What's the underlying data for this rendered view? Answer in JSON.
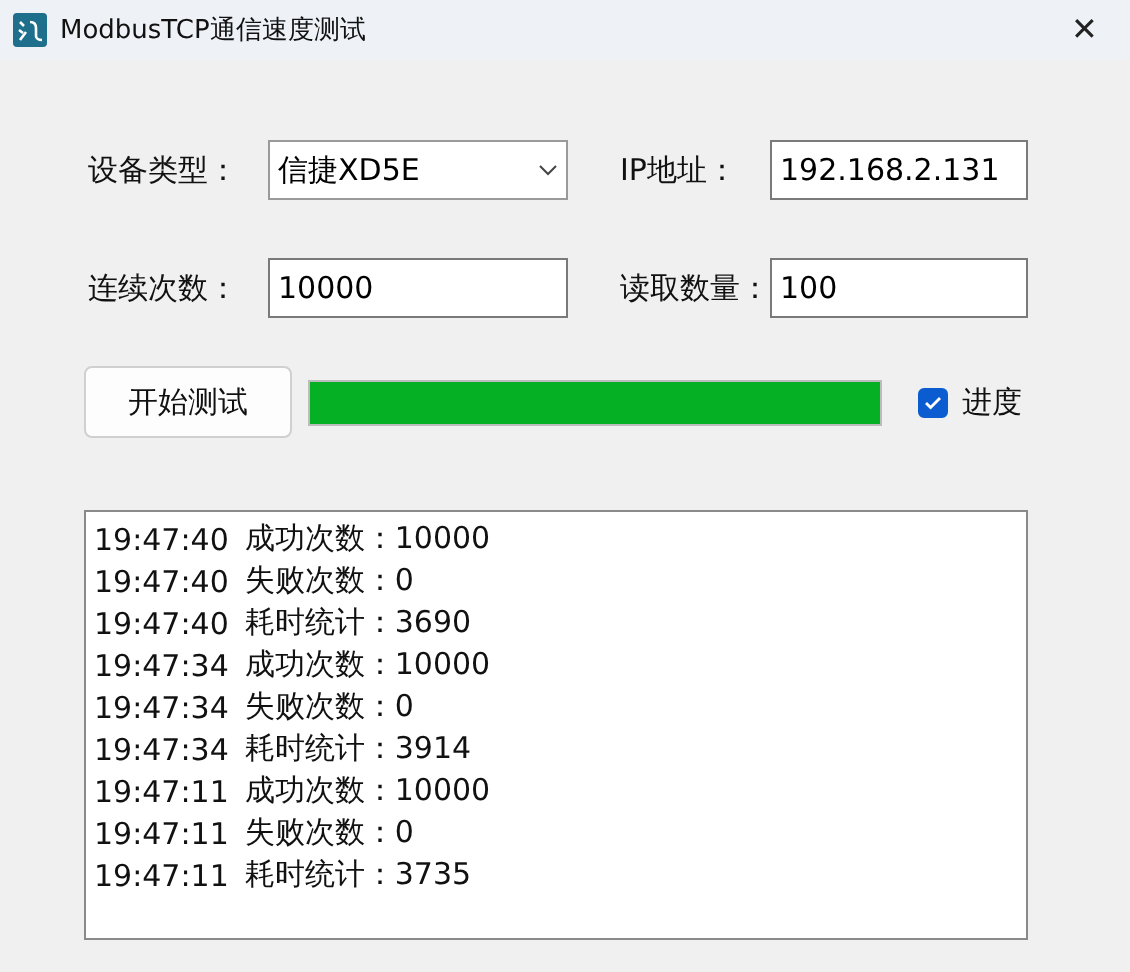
{
  "window": {
    "title": "ModbusTCP通信速度测试",
    "close": "✕"
  },
  "device_type": {
    "label": "设备类型：",
    "value": "信捷XD5E"
  },
  "ip_address": {
    "label": "IP地址：",
    "value": "192.168.2.131"
  },
  "repeat_count": {
    "label": "连续次数：",
    "value": "10000"
  },
  "read_count": {
    "label": "读取数量：",
    "value": "100"
  },
  "start_button": "开始测试",
  "progress": {
    "level": 1.0
  },
  "progress_checkbox": {
    "label": "进度",
    "checked": true
  },
  "log": [
    {
      "time": "19:47:40",
      "text": "成功次数：10000"
    },
    {
      "time": "19:47:40",
      "text": "失败次数：0"
    },
    {
      "time": "19:47:40",
      "text": "耗时统计：3690"
    },
    {
      "time": "19:47:34",
      "text": "成功次数：10000"
    },
    {
      "time": "19:47:34",
      "text": "失败次数：0"
    },
    {
      "time": "19:47:34",
      "text": "耗时统计：3914"
    },
    {
      "time": "19:47:11",
      "text": "成功次数：10000"
    },
    {
      "time": "19:47:11",
      "text": "失败次数：0"
    },
    {
      "time": "19:47:11",
      "text": "耗时统计：3735"
    }
  ]
}
